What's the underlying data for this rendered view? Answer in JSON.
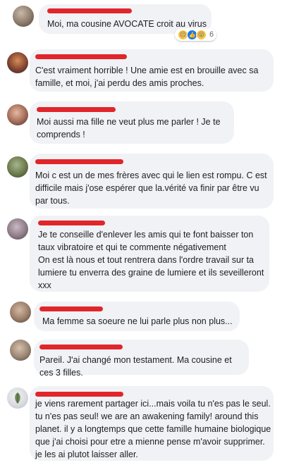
{
  "comments": [
    {
      "text": "Moi, ma cousine AVOCATE croit au virus",
      "reactions": {
        "count": "6"
      }
    },
    {
      "text": "C'est vraiment horrible ! Une amie est en brouille avec sa famille, et moi, j'ai perdu des amis proches."
    },
    {
      "text": "Moi aussi ma fille ne veut plus me parler ! Je te comprends !"
    },
    {
      "text": "Moi c est un de mes frères avec qui le lien est rompu. C est difficile mais j'ose espérer que la.vérité va finir par être vu par tous."
    },
    {
      "text": "Je te conseille d'enlever les amis qui te font baisser ton taux vibratoire et qui te commente négativement\nOn est là nous et tout rentrera dans l'ordre travail sur ta lumiere tu enverra des graine de lumiere et ils seveilleront xxx"
    },
    {
      "text": "Ma femme sa soeure ne lui parle plus non plus..."
    },
    {
      "text": "Pareil. J'ai changé mon testament. Ma cousine et ces 3 filles."
    },
    {
      "text": "je viens rarement partager ici...mais voila tu n'es pas le seul. tu n'es pas seul! we are an awakening family! around this planet. il y a longtemps que cette famille humaine biologique que j'ai choisi pour etre a mienne pense m'avoir supprimer. je les ai plutot laisser aller."
    }
  ]
}
